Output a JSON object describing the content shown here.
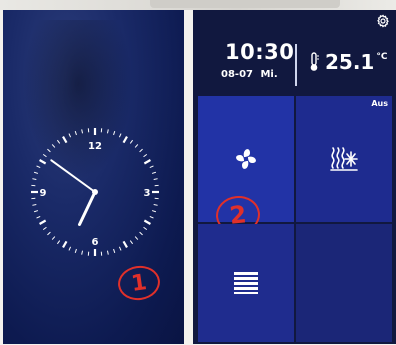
{
  "left_screen": {
    "clock": {
      "numerals": [
        "12",
        "3",
        "6",
        "9"
      ],
      "hour": 6,
      "minute": 51
    },
    "annotation": "1"
  },
  "right_screen": {
    "settings_icon": "gear-icon",
    "time": "10:30",
    "date": "08-07",
    "weekday": "Mi.",
    "temperature": "25.1",
    "temperature_unit": "°C",
    "tiles": [
      {
        "icon": "fan-icon",
        "status": ""
      },
      {
        "icon": "floor-heating-icon",
        "status": "Aus"
      },
      {
        "icon": "blinds-icon",
        "status": ""
      },
      {
        "icon": "",
        "status": ""
      }
    ],
    "annotation": "2"
  },
  "colors": {
    "screen_bg": "#11183f",
    "tile_bg": "#1f2c8e",
    "annotation_red": "#e0302a"
  }
}
